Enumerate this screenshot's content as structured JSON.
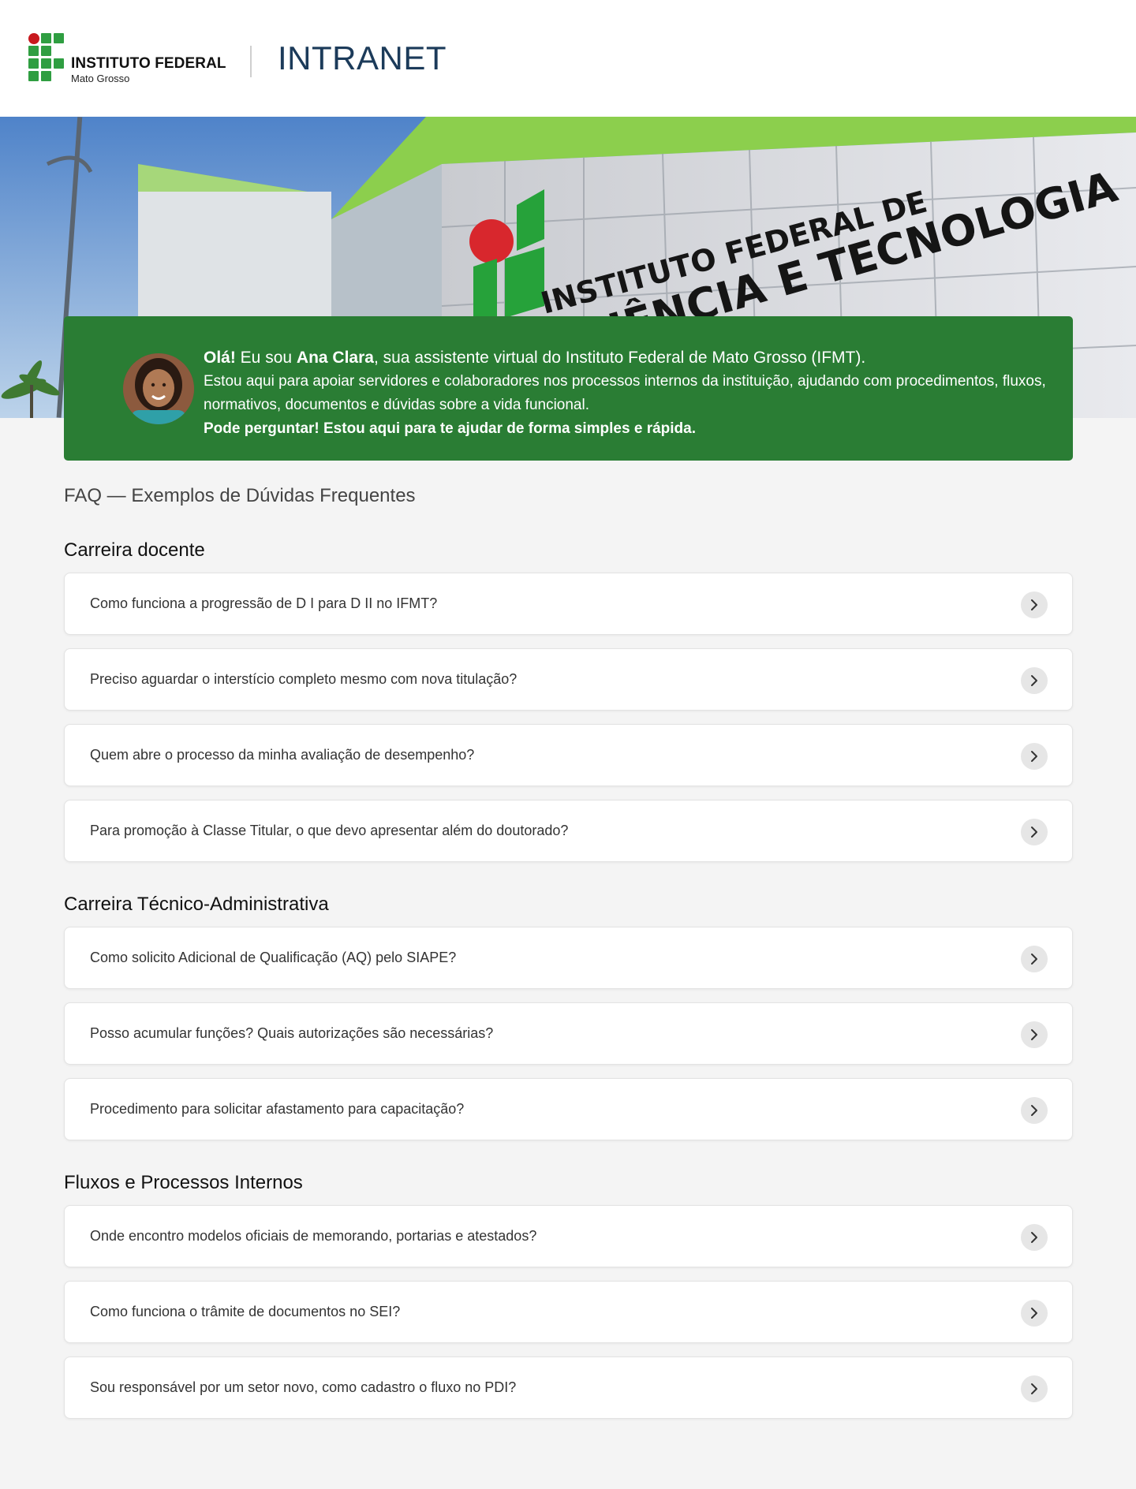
{
  "header": {
    "logo_title": "INSTITUTO FEDERAL",
    "logo_subtitle": "Mato Grosso",
    "app_name": "INTRANET"
  },
  "hero": {
    "building_sign_line1": "INSTITUTO FEDERAL DE",
    "building_sign_line2": "CIÊNCIA E TECNOLOGIA"
  },
  "welcome": {
    "greeting": "Olá!",
    "intro_pre": " Eu sou ",
    "assistant_name": "Ana Clara",
    "intro_post": ", sua assistente virtual do Instituto Federal de Mato Grosso (IFMT).",
    "description": "Estou aqui para apoiar servidores e colaboradores nos processos internos da instituição, ajudando com procedimentos, fluxos, normativos, documentos e dúvidas sobre a vida funcional.",
    "cta": "Pode perguntar! Estou aqui para te ajudar de forma simples e rápida."
  },
  "faq": {
    "title": "FAQ — Exemplos de Dúvidas Frequentes",
    "sections": [
      {
        "title": "Carreira docente",
        "questions": [
          "Como funciona a progressão de D I para D II no IFMT?",
          "Preciso aguardar o interstício completo mesmo com nova titulação?",
          "Quem abre o processo da minha avaliação de desempenho?",
          "Para promoção à Classe Titular, o que devo apresentar além do doutorado?"
        ]
      },
      {
        "title": "Carreira Técnico-Administrativa",
        "questions": [
          "Como solicito Adicional de Qualificação (AQ) pelo SIAPE?",
          "Posso acumular funções? Quais autorizações são necessárias?",
          "Procedimento para solicitar afastamento para capacitação?"
        ]
      },
      {
        "title": "Fluxos e Processos Internos",
        "questions": [
          "Onde encontro modelos oficiais de memorando, portarias e atestados?",
          "Como funciona o trâmite de documentos no SEI?",
          "Sou responsável por um setor novo, como cadastro o fluxo no PDI?"
        ]
      }
    ]
  },
  "icons": {
    "question_action": "chevron-right-icon"
  },
  "colors": {
    "brand_green": "#2a7d34",
    "logo_green": "#2f9e41",
    "logo_red": "#c8191e",
    "intranet_blue": "#1c3b5a",
    "page_background": "#f4f4f4"
  }
}
